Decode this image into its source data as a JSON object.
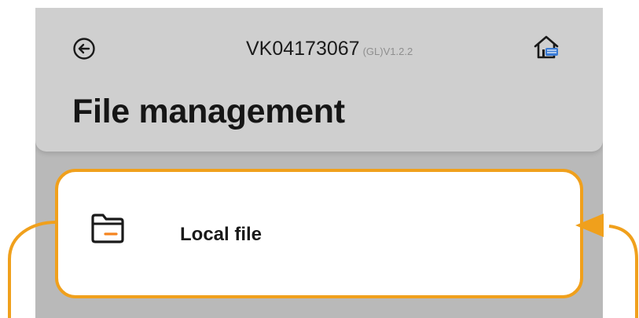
{
  "header": {
    "device_id": "VK04173067",
    "version": "(GL)V1.2.2",
    "back_icon": "arrow-left-circle-icon",
    "home_icon": "home-network-icon"
  },
  "page": {
    "title": "File management"
  },
  "list": {
    "items": [
      {
        "label": "Local file",
        "icon": "folder-icon",
        "highlighted": true
      }
    ]
  },
  "colors": {
    "highlight": "#f0a01c",
    "header_bg": "#cfcfcf",
    "body_bg": "#b9b9b9",
    "icon_accent": "#f5841f",
    "home_accent": "#3a7bd5"
  }
}
